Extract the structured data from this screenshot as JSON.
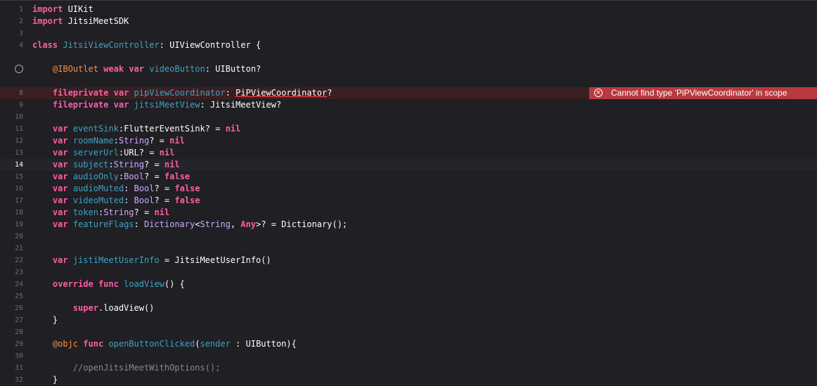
{
  "editor": {
    "lines": [
      {
        "n": "1",
        "tokens": [
          [
            "kw",
            "import"
          ],
          [
            "plain",
            " UIKit"
          ]
        ]
      },
      {
        "n": "2",
        "tokens": [
          [
            "kw",
            "import"
          ],
          [
            "plain",
            " JitsiMeetSDK"
          ]
        ]
      },
      {
        "n": "3",
        "tokens": []
      },
      {
        "n": "4",
        "tokens": [
          [
            "kw",
            "class"
          ],
          [
            "plain",
            " "
          ],
          [
            "decl",
            "JitsiViewController"
          ],
          [
            "plain",
            ": UIViewController {"
          ]
        ]
      },
      {
        "n": "",
        "breakpoint": true,
        "tokens": []
      },
      {
        "n": "",
        "tokens": [
          [
            "plain",
            "    "
          ],
          [
            "attr",
            "@IBOutlet"
          ],
          [
            "plain",
            " "
          ],
          [
            "kw",
            "weak"
          ],
          [
            "plain",
            " "
          ],
          [
            "kw",
            "var"
          ],
          [
            "plain",
            " "
          ],
          [
            "decl",
            "videoButton"
          ],
          [
            "plain",
            ": UIButton?"
          ]
        ]
      },
      {
        "n": "",
        "tokens": []
      },
      {
        "n": "8",
        "error": true,
        "tokens": [
          [
            "plain",
            "    "
          ],
          [
            "kw",
            "fileprivate"
          ],
          [
            "plain",
            " "
          ],
          [
            "kw",
            "var"
          ],
          [
            "plain",
            " "
          ],
          [
            "decl",
            "pipViewCoordinator"
          ],
          [
            "plain",
            ": "
          ],
          [
            "errtype",
            "PiPViewCoordinator"
          ],
          [
            "plain",
            "?"
          ]
        ]
      },
      {
        "n": "9",
        "tokens": [
          [
            "plain",
            "    "
          ],
          [
            "kw",
            "fileprivate"
          ],
          [
            "plain",
            " "
          ],
          [
            "kw",
            "var"
          ],
          [
            "plain",
            " "
          ],
          [
            "decl",
            "jitsiMeetView"
          ],
          [
            "plain",
            ": JitsiMeetView?"
          ]
        ]
      },
      {
        "n": "10",
        "tokens": []
      },
      {
        "n": "11",
        "tokens": [
          [
            "plain",
            "    "
          ],
          [
            "kw",
            "var"
          ],
          [
            "plain",
            " "
          ],
          [
            "decl",
            "eventSink"
          ],
          [
            "plain",
            ":FlutterEventSink? = "
          ],
          [
            "kw",
            "nil"
          ]
        ]
      },
      {
        "n": "12",
        "tokens": [
          [
            "plain",
            "    "
          ],
          [
            "kw",
            "var"
          ],
          [
            "plain",
            " "
          ],
          [
            "decl",
            "roomName"
          ],
          [
            "plain",
            ":"
          ],
          [
            "type",
            "String"
          ],
          [
            "plain",
            "? = "
          ],
          [
            "kw",
            "nil"
          ]
        ]
      },
      {
        "n": "13",
        "tokens": [
          [
            "plain",
            "    "
          ],
          [
            "kw",
            "var"
          ],
          [
            "plain",
            " "
          ],
          [
            "decl",
            "serverUrl"
          ],
          [
            "plain",
            ":URL? = "
          ],
          [
            "kw",
            "nil"
          ]
        ]
      },
      {
        "n": "14",
        "current": true,
        "tokens": [
          [
            "plain",
            "    "
          ],
          [
            "kw",
            "var"
          ],
          [
            "plain",
            " "
          ],
          [
            "decl",
            "subject"
          ],
          [
            "plain",
            ":"
          ],
          [
            "type",
            "String"
          ],
          [
            "plain",
            "? = "
          ],
          [
            "kw",
            "nil"
          ]
        ]
      },
      {
        "n": "15",
        "tokens": [
          [
            "plain",
            "    "
          ],
          [
            "kw",
            "var"
          ],
          [
            "plain",
            " "
          ],
          [
            "decl",
            "audioOnly"
          ],
          [
            "plain",
            ":"
          ],
          [
            "type",
            "Bool"
          ],
          [
            "plain",
            "? = "
          ],
          [
            "kw",
            "false"
          ]
        ]
      },
      {
        "n": "16",
        "tokens": [
          [
            "plain",
            "    "
          ],
          [
            "kw",
            "var"
          ],
          [
            "plain",
            " "
          ],
          [
            "decl",
            "audioMuted"
          ],
          [
            "plain",
            ": "
          ],
          [
            "type",
            "Bool"
          ],
          [
            "plain",
            "? = "
          ],
          [
            "kw",
            "false"
          ]
        ]
      },
      {
        "n": "17",
        "tokens": [
          [
            "plain",
            "    "
          ],
          [
            "kw",
            "var"
          ],
          [
            "plain",
            " "
          ],
          [
            "decl",
            "videoMuted"
          ],
          [
            "plain",
            ": "
          ],
          [
            "type",
            "Bool"
          ],
          [
            "plain",
            "? = "
          ],
          [
            "kw",
            "false"
          ]
        ]
      },
      {
        "n": "18",
        "tokens": [
          [
            "plain",
            "    "
          ],
          [
            "kw",
            "var"
          ],
          [
            "plain",
            " "
          ],
          [
            "decl",
            "token"
          ],
          [
            "plain",
            ":"
          ],
          [
            "type",
            "String"
          ],
          [
            "plain",
            "? = "
          ],
          [
            "kw",
            "nil"
          ]
        ]
      },
      {
        "n": "19",
        "tokens": [
          [
            "plain",
            "    "
          ],
          [
            "kw",
            "var"
          ],
          [
            "plain",
            " "
          ],
          [
            "decl",
            "featureFlags"
          ],
          [
            "plain",
            ": "
          ],
          [
            "type",
            "Dictionary"
          ],
          [
            "plain",
            "<"
          ],
          [
            "type",
            "String"
          ],
          [
            "plain",
            ", "
          ],
          [
            "kw",
            "Any"
          ],
          [
            "plain",
            ">? = Dictionary();"
          ]
        ]
      },
      {
        "n": "20",
        "tokens": []
      },
      {
        "n": "21",
        "tokens": []
      },
      {
        "n": "22",
        "tokens": [
          [
            "plain",
            "    "
          ],
          [
            "kw",
            "var"
          ],
          [
            "plain",
            " "
          ],
          [
            "decl",
            "jistiMeetUserInfo"
          ],
          [
            "plain",
            " = JitsiMeetUserInfo()"
          ]
        ]
      },
      {
        "n": "23",
        "tokens": []
      },
      {
        "n": "24",
        "tokens": [
          [
            "plain",
            "    "
          ],
          [
            "kw",
            "override"
          ],
          [
            "plain",
            " "
          ],
          [
            "kw",
            "func"
          ],
          [
            "plain",
            " "
          ],
          [
            "decl",
            "loadView"
          ],
          [
            "plain",
            "() {"
          ]
        ]
      },
      {
        "n": "25",
        "tokens": []
      },
      {
        "n": "26",
        "tokens": [
          [
            "plain",
            "        "
          ],
          [
            "kw",
            "super"
          ],
          [
            "plain",
            ".loadView()"
          ]
        ]
      },
      {
        "n": "27",
        "tokens": [
          [
            "plain",
            "    }"
          ]
        ]
      },
      {
        "n": "28",
        "tokens": []
      },
      {
        "n": "29",
        "tokens": [
          [
            "plain",
            "    "
          ],
          [
            "attr",
            "@objc"
          ],
          [
            "plain",
            " "
          ],
          [
            "kw",
            "func"
          ],
          [
            "plain",
            " "
          ],
          [
            "decl",
            "openButtonClicked"
          ],
          [
            "plain",
            "("
          ],
          [
            "decl",
            "sender"
          ],
          [
            "plain",
            " : UIButton){"
          ]
        ]
      },
      {
        "n": "30",
        "tokens": []
      },
      {
        "n": "31",
        "tokens": [
          [
            "plain",
            "        "
          ],
          [
            "comment",
            "//openJitsiMeetWithOptions();"
          ]
        ]
      },
      {
        "n": "32",
        "tokens": [
          [
            "plain",
            "    }"
          ]
        ]
      }
    ]
  },
  "error": {
    "line": "8",
    "message": "Cannot find type 'PiPViewCoordinator' in scope",
    "icon": "error-x-icon",
    "glyph": "×",
    "color": "#b73a3f"
  }
}
